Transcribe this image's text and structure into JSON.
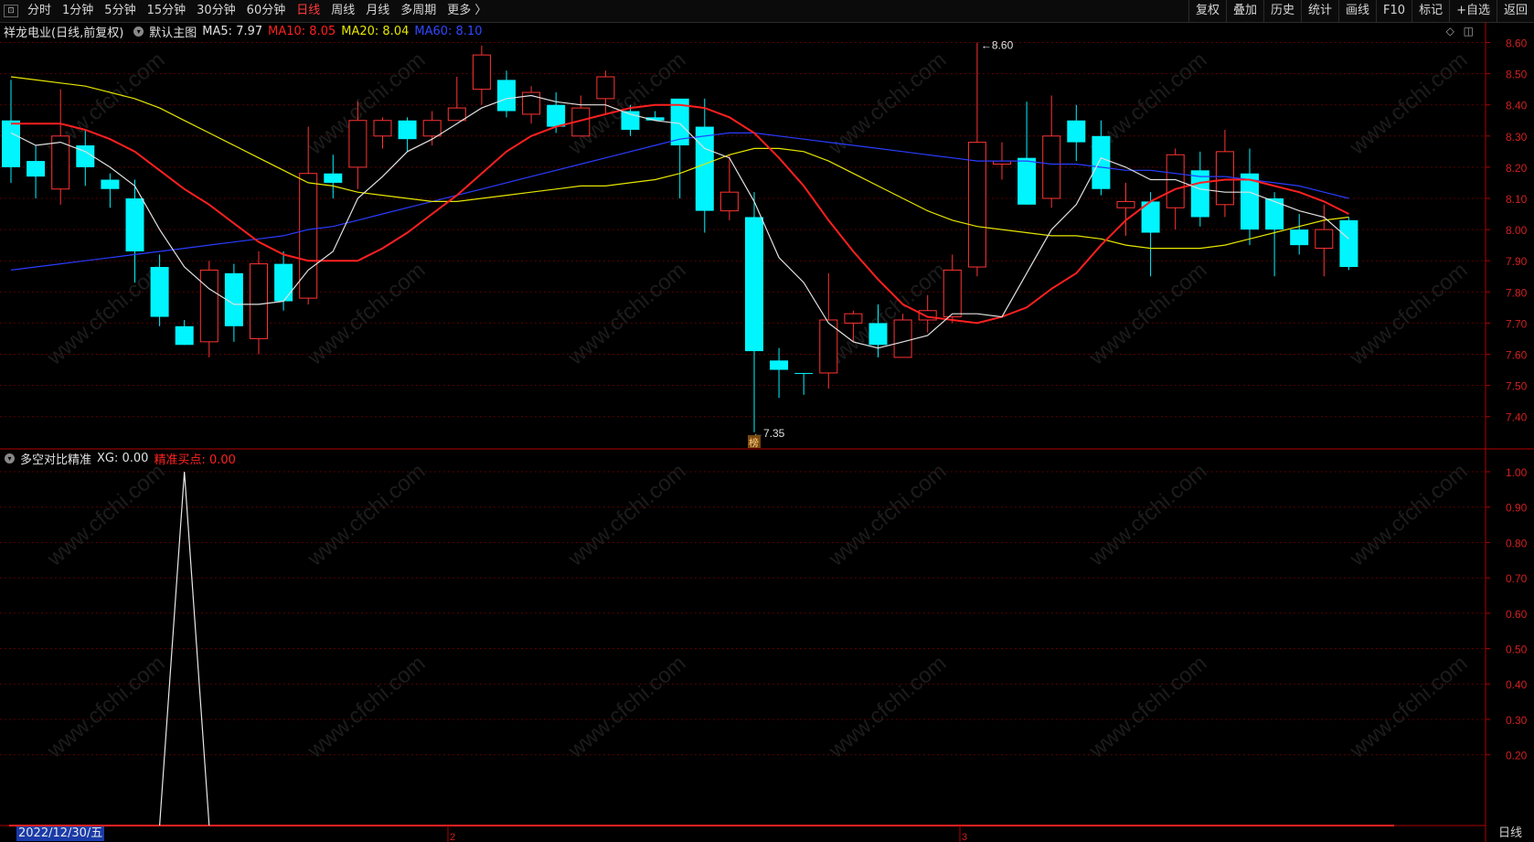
{
  "toolbar": {
    "periods": [
      "分时",
      "1分钟",
      "5分钟",
      "15分钟",
      "30分钟",
      "60分钟",
      "日线",
      "周线",
      "月线",
      "多周期",
      "更多 〉"
    ],
    "active_period": "日线",
    "right_buttons": [
      "复权",
      "叠加",
      "历史",
      "统计",
      "画线",
      "F10",
      "标记",
      "+自选",
      "返回"
    ]
  },
  "main_legend": {
    "stock": "祥龙电业(日线,前复权)",
    "template": "默认主图",
    "ma5": "MA5: 7.97",
    "ma10": "MA10: 8.05",
    "ma20": "MA20: 8.04",
    "ma60": "MA60: 8.10"
  },
  "sub_legend": {
    "name": "多空对比精准",
    "xg": "XG: 0.00",
    "buy": "精准买点: 0.00"
  },
  "annotations": {
    "high": "8.60",
    "low": "7.35",
    "badge": "榜"
  },
  "footer": {
    "date": "2022/12/30/五",
    "period_tag": "日线",
    "month_marks": [
      "2",
      "3"
    ]
  },
  "watermark": "www.cfchi.com",
  "colors": {
    "up": "#ff3333",
    "down": "#00f5ff",
    "ma5": "#e0e0e0",
    "ma10": "#ff2020",
    "ma20": "#e6e600",
    "ma60": "#2a3cff"
  },
  "chart_data": [
    {
      "type": "candlestick",
      "title": "祥龙电业(日线,前复权)",
      "ylim": [
        7.35,
        8.65
      ],
      "yticks": [
        "8.60",
        "8.50",
        "8.40",
        "8.30",
        "8.20",
        "8.10",
        "8.00",
        "7.90",
        "7.80",
        "7.70",
        "7.60",
        "7.50",
        "7.40"
      ],
      "candles": [
        {
          "o": 8.35,
          "c": 8.2,
          "h": 8.48,
          "l": 8.15
        },
        {
          "o": 8.22,
          "c": 8.17,
          "h": 8.27,
          "l": 8.1
        },
        {
          "o": 8.13,
          "c": 8.3,
          "h": 8.45,
          "l": 8.08
        },
        {
          "o": 8.27,
          "c": 8.2,
          "h": 8.32,
          "l": 8.14
        },
        {
          "o": 8.16,
          "c": 8.13,
          "h": 8.18,
          "l": 8.07
        },
        {
          "o": 8.1,
          "c": 7.93,
          "h": 8.16,
          "l": 7.83
        },
        {
          "o": 7.88,
          "c": 7.72,
          "h": 7.92,
          "l": 7.69
        },
        {
          "o": 7.69,
          "c": 7.63,
          "h": 7.71,
          "l": 7.63
        },
        {
          "o": 7.64,
          "c": 7.87,
          "h": 7.9,
          "l": 7.59
        },
        {
          "o": 7.86,
          "c": 7.69,
          "h": 7.89,
          "l": 7.64
        },
        {
          "o": 7.65,
          "c": 7.89,
          "h": 7.93,
          "l": 7.6
        },
        {
          "o": 7.89,
          "c": 7.77,
          "h": 7.93,
          "l": 7.74
        },
        {
          "o": 7.78,
          "c": 8.18,
          "h": 8.33,
          "l": 7.76
        },
        {
          "o": 8.18,
          "c": 8.15,
          "h": 8.24,
          "l": 8.1
        },
        {
          "o": 8.2,
          "c": 8.35,
          "h": 8.41,
          "l": 8.13
        },
        {
          "o": 8.3,
          "c": 8.35,
          "h": 8.36,
          "l": 8.26
        },
        {
          "o": 8.35,
          "c": 8.29,
          "h": 8.36,
          "l": 8.25
        },
        {
          "o": 8.3,
          "c": 8.35,
          "h": 8.38,
          "l": 8.27
        },
        {
          "o": 8.35,
          "c": 8.39,
          "h": 8.49,
          "l": 8.35
        },
        {
          "o": 8.45,
          "c": 8.56,
          "h": 8.59,
          "l": 8.4
        },
        {
          "o": 8.48,
          "c": 8.38,
          "h": 8.51,
          "l": 8.36
        },
        {
          "o": 8.37,
          "c": 8.44,
          "h": 8.46,
          "l": 8.34
        },
        {
          "o": 8.4,
          "c": 8.33,
          "h": 8.44,
          "l": 8.31
        },
        {
          "o": 8.3,
          "c": 8.39,
          "h": 8.43,
          "l": 8.3
        },
        {
          "o": 8.42,
          "c": 8.49,
          "h": 8.51,
          "l": 8.37
        },
        {
          "o": 8.38,
          "c": 8.32,
          "h": 8.4,
          "l": 8.3
        },
        {
          "o": 8.36,
          "c": 8.35,
          "h": 8.38,
          "l": 8.35
        },
        {
          "o": 8.42,
          "c": 8.27,
          "h": 8.42,
          "l": 8.1
        },
        {
          "o": 8.33,
          "c": 8.06,
          "h": 8.42,
          "l": 7.99
        },
        {
          "o": 8.06,
          "c": 8.12,
          "h": 8.24,
          "l": 8.03
        },
        {
          "o": 8.04,
          "c": 7.61,
          "h": 8.12,
          "l": 7.35
        },
        {
          "o": 7.58,
          "c": 7.55,
          "h": 7.62,
          "l": 7.46
        },
        {
          "o": 7.54,
          "c": 7.54,
          "h": 7.54,
          "l": 7.47
        },
        {
          "o": 7.54,
          "c": 7.71,
          "h": 7.86,
          "l": 7.49
        },
        {
          "o": 7.7,
          "c": 7.73,
          "h": 7.74,
          "l": 7.64
        },
        {
          "o": 7.7,
          "c": 7.63,
          "h": 7.76,
          "l": 7.59
        },
        {
          "o": 7.59,
          "c": 7.71,
          "h": 7.73,
          "l": 7.59
        },
        {
          "o": 7.71,
          "c": 7.74,
          "h": 7.79,
          "l": 7.67
        },
        {
          "o": 7.72,
          "c": 7.87,
          "h": 7.92,
          "l": 7.7
        },
        {
          "o": 7.88,
          "c": 8.28,
          "h": 8.6,
          "l": 7.85
        },
        {
          "o": 8.21,
          "c": 8.22,
          "h": 8.28,
          "l": 8.16
        },
        {
          "o": 8.23,
          "c": 8.08,
          "h": 8.41,
          "l": 8.08
        },
        {
          "o": 8.1,
          "c": 8.3,
          "h": 8.43,
          "l": 8.07
        },
        {
          "o": 8.35,
          "c": 8.28,
          "h": 8.4,
          "l": 8.22
        },
        {
          "o": 8.3,
          "c": 8.13,
          "h": 8.35,
          "l": 8.11
        },
        {
          "o": 8.07,
          "c": 8.09,
          "h": 8.15,
          "l": 7.98
        },
        {
          "o": 8.09,
          "c": 7.99,
          "h": 8.12,
          "l": 7.85
        },
        {
          "o": 8.07,
          "c": 8.24,
          "h": 8.26,
          "l": 8.0
        },
        {
          "o": 8.19,
          "c": 8.04,
          "h": 8.25,
          "l": 8.01
        },
        {
          "o": 8.08,
          "c": 8.25,
          "h": 8.32,
          "l": 8.04
        },
        {
          "o": 8.18,
          "c": 8.0,
          "h": 8.26,
          "l": 7.95
        },
        {
          "o": 8.1,
          "c": 8.0,
          "h": 8.12,
          "l": 7.85
        },
        {
          "o": 8.0,
          "c": 7.95,
          "h": 8.05,
          "l": 7.92
        },
        {
          "o": 7.94,
          "c": 8.0,
          "h": 8.08,
          "l": 7.85
        },
        {
          "o": 8.03,
          "c": 7.88,
          "h": 8.04,
          "l": 7.87
        }
      ],
      "ma5": [
        8.31,
        8.27,
        8.28,
        8.25,
        8.2,
        8.14,
        8.0,
        7.88,
        7.81,
        7.76,
        7.76,
        7.77,
        7.87,
        7.93,
        8.1,
        8.17,
        8.25,
        8.29,
        8.34,
        8.39,
        8.42,
        8.43,
        8.41,
        8.4,
        8.4,
        8.37,
        8.35,
        8.34,
        8.26,
        8.23,
        8.09,
        7.91,
        7.83,
        7.7,
        7.64,
        7.62,
        7.64,
        7.66,
        7.73,
        7.73,
        7.72,
        7.86,
        8.0,
        8.08,
        8.23,
        8.2,
        8.16,
        8.16,
        8.13,
        8.12,
        8.12,
        8.09,
        8.06,
        8.04,
        7.97
      ],
      "ma10": [
        8.34,
        8.34,
        8.34,
        8.32,
        8.29,
        8.25,
        8.19,
        8.13,
        8.08,
        8.02,
        7.96,
        7.92,
        7.9,
        7.9,
        7.9,
        7.94,
        7.99,
        8.05,
        8.11,
        8.18,
        8.25,
        8.3,
        8.33,
        8.35,
        8.37,
        8.39,
        8.4,
        8.4,
        8.39,
        8.36,
        8.31,
        8.23,
        8.14,
        8.03,
        7.93,
        7.84,
        7.76,
        7.72,
        7.71,
        7.7,
        7.72,
        7.75,
        7.81,
        7.86,
        7.95,
        8.03,
        8.09,
        8.13,
        8.15,
        8.16,
        8.16,
        8.14,
        8.12,
        8.09,
        8.05
      ],
      "ma20": [
        8.49,
        8.48,
        8.47,
        8.46,
        8.44,
        8.42,
        8.39,
        8.35,
        8.31,
        8.27,
        8.23,
        8.19,
        8.15,
        8.14,
        8.12,
        8.11,
        8.1,
        8.09,
        8.09,
        8.1,
        8.11,
        8.12,
        8.13,
        8.14,
        8.14,
        8.15,
        8.16,
        8.18,
        8.21,
        8.24,
        8.26,
        8.26,
        8.25,
        8.22,
        8.18,
        8.14,
        8.1,
        8.06,
        8.03,
        8.01,
        8.0,
        7.99,
        7.98,
        7.98,
        7.97,
        7.95,
        7.94,
        7.94,
        7.94,
        7.95,
        7.97,
        7.99,
        8.01,
        8.03,
        8.04
      ],
      "ma60": [
        7.87,
        7.88,
        7.89,
        7.9,
        7.91,
        7.92,
        7.93,
        7.94,
        7.95,
        7.96,
        7.97,
        7.98,
        8.0,
        8.01,
        8.03,
        8.05,
        8.07,
        8.09,
        8.11,
        8.13,
        8.15,
        8.17,
        8.19,
        8.21,
        8.23,
        8.25,
        8.27,
        8.29,
        8.3,
        8.31,
        8.31,
        8.3,
        8.29,
        8.28,
        8.27,
        8.26,
        8.25,
        8.24,
        8.23,
        8.22,
        8.22,
        8.22,
        8.21,
        8.21,
        8.2,
        8.19,
        8.19,
        8.18,
        8.17,
        8.17,
        8.16,
        8.15,
        8.14,
        8.12,
        8.1
      ]
    },
    {
      "type": "line",
      "title": "多空对比精准",
      "ylim": [
        0,
        1
      ],
      "yticks": [
        "1.00",
        "0.90",
        "0.80",
        "0.70",
        "0.60",
        "0.50",
        "0.40",
        "0.30",
        "0.20"
      ],
      "x_index": [
        6,
        7,
        8
      ],
      "values": [
        0,
        1,
        0
      ]
    }
  ]
}
